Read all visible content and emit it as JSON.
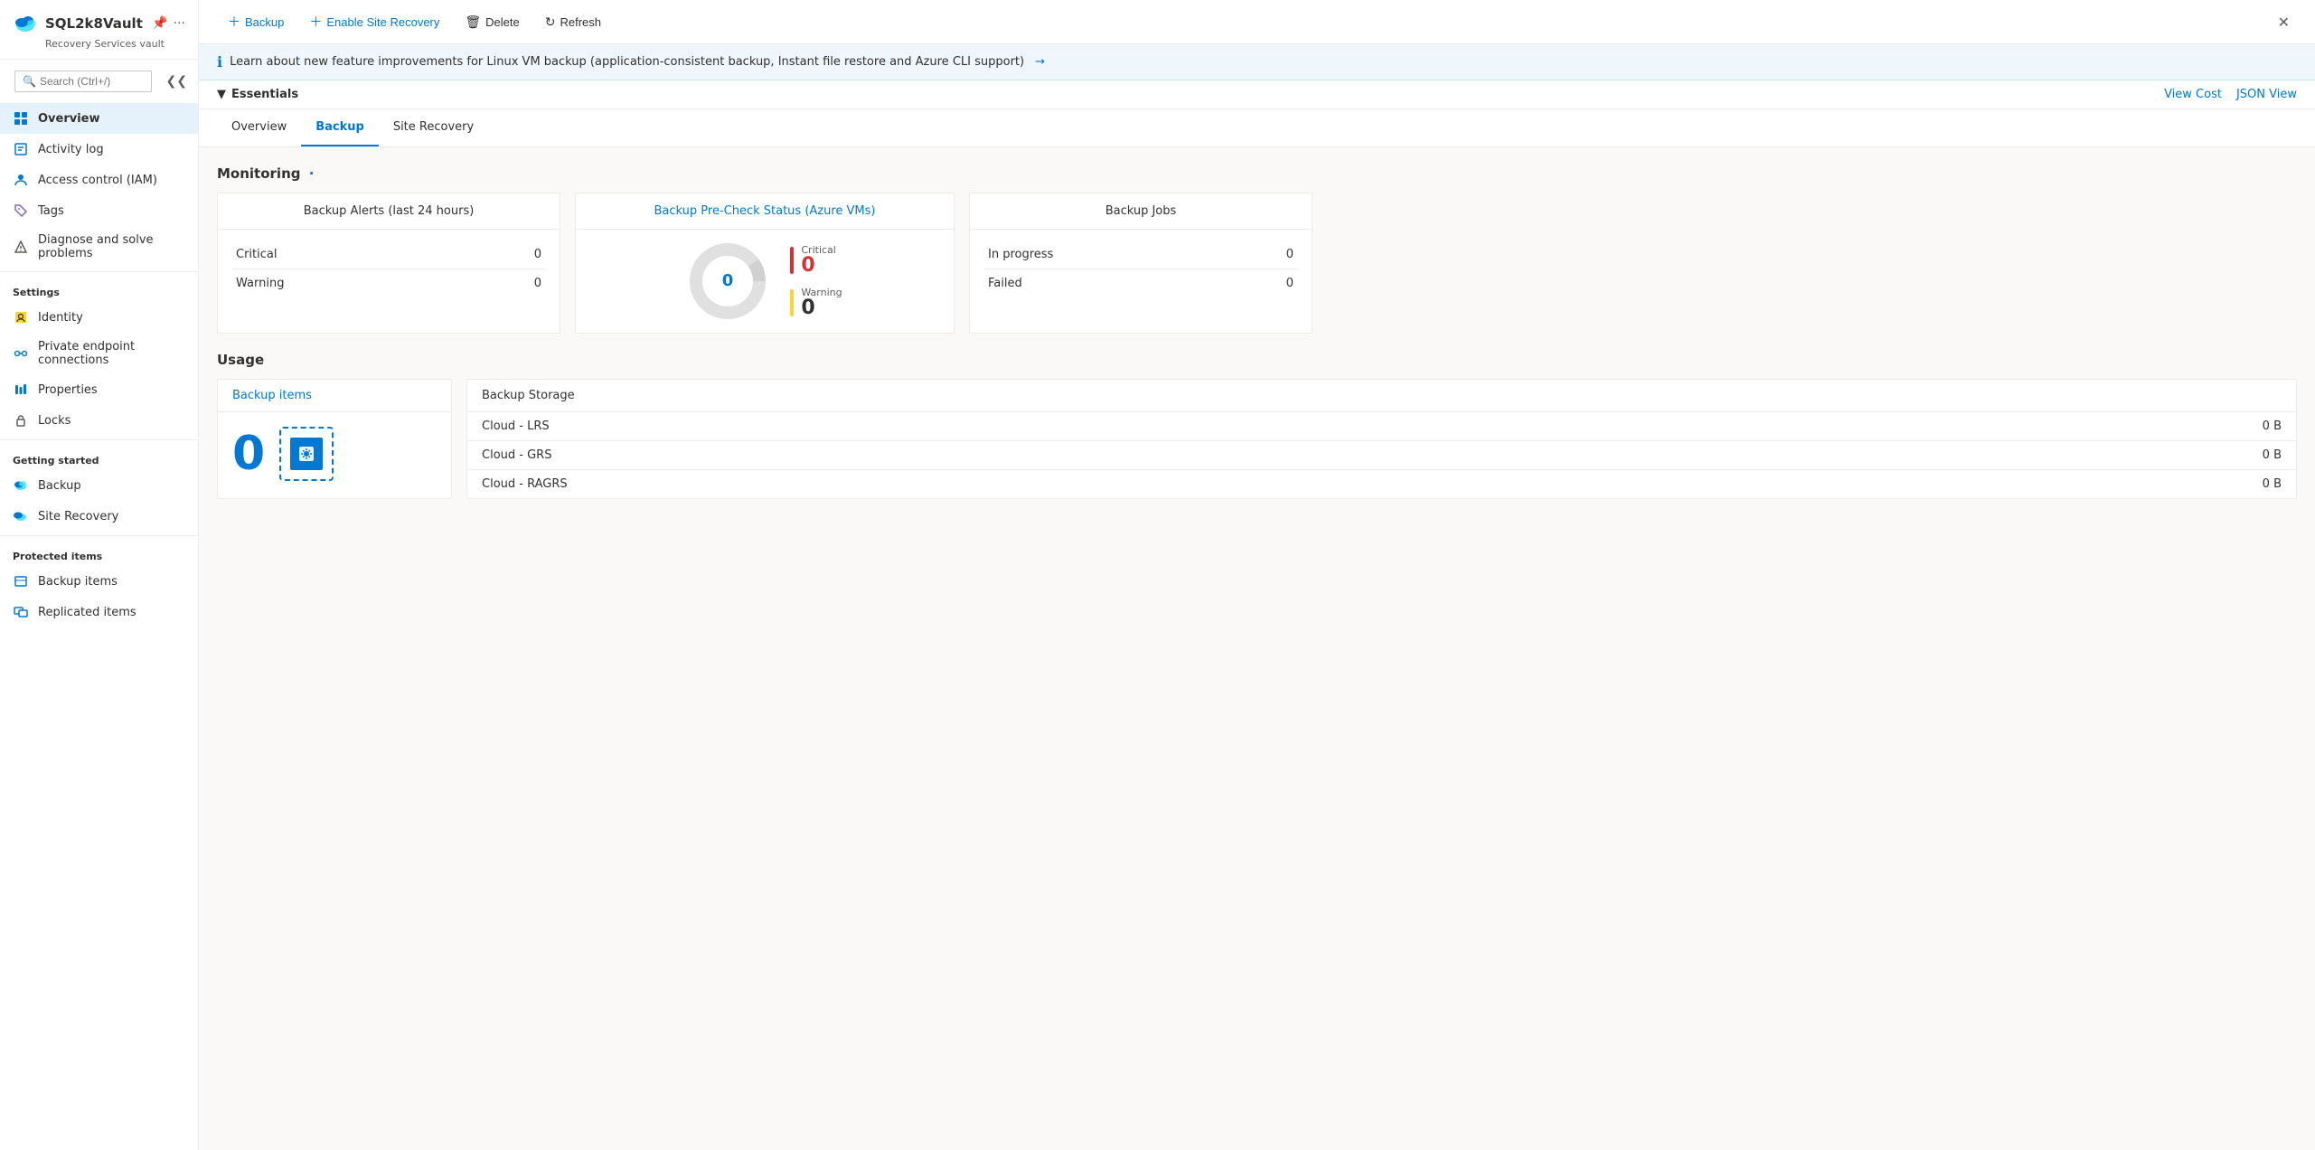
{
  "window": {
    "title": "SQL2k8Vault",
    "subtitle": "Recovery Services vault",
    "close_label": "✕"
  },
  "sidebar": {
    "search_placeholder": "Search (Ctrl+/)",
    "collapse_icon": "❮❮",
    "nav_items": [
      {
        "id": "overview",
        "label": "Overview",
        "icon": "overview",
        "active": true
      },
      {
        "id": "activity-log",
        "label": "Activity log",
        "icon": "activity"
      },
      {
        "id": "access-control",
        "label": "Access control (IAM)",
        "icon": "iam"
      },
      {
        "id": "tags",
        "label": "Tags",
        "icon": "tags"
      },
      {
        "id": "diagnose",
        "label": "Diagnose and solve problems",
        "icon": "diagnose"
      }
    ],
    "settings_label": "Settings",
    "settings_items": [
      {
        "id": "identity",
        "label": "Identity",
        "icon": "identity"
      },
      {
        "id": "private-endpoints",
        "label": "Private endpoint connections",
        "icon": "private-ep"
      },
      {
        "id": "properties",
        "label": "Properties",
        "icon": "properties"
      },
      {
        "id": "locks",
        "label": "Locks",
        "icon": "locks"
      }
    ],
    "getting_started_label": "Getting started",
    "getting_started_items": [
      {
        "id": "backup",
        "label": "Backup",
        "icon": "backup"
      },
      {
        "id": "site-recovery",
        "label": "Site Recovery",
        "icon": "site-recovery"
      }
    ],
    "protected_items_label": "Protected items",
    "protected_items": [
      {
        "id": "backup-items",
        "label": "Backup items",
        "icon": "backup-items"
      },
      {
        "id": "replicated-items",
        "label": "Replicated items",
        "icon": "replicated"
      }
    ]
  },
  "toolbar": {
    "backup_label": "Backup",
    "enable_site_recovery_label": "Enable Site Recovery",
    "delete_label": "Delete",
    "refresh_label": "Refresh"
  },
  "banner": {
    "text": "Learn about new feature improvements for Linux VM backup (application-consistent backup, Instant file restore and Azure CLI support)",
    "arrow": "→"
  },
  "essentials": {
    "label": "Essentials",
    "view_cost_label": "View Cost",
    "json_view_label": "JSON View"
  },
  "tabs": [
    {
      "id": "overview",
      "label": "Overview",
      "active": false
    },
    {
      "id": "backup",
      "label": "Backup",
      "active": true
    },
    {
      "id": "site-recovery",
      "label": "Site Recovery",
      "active": false
    }
  ],
  "monitoring": {
    "title": "Monitoring",
    "backup_alerts": {
      "title": "Backup Alerts (last 24 hours)",
      "rows": [
        {
          "label": "Critical",
          "value": "0"
        },
        {
          "label": "Warning",
          "value": "0"
        }
      ]
    },
    "pre_check": {
      "title": "Backup Pre-Check Status (Azure VMs)",
      "center_value": "0",
      "legend": [
        {
          "type": "critical",
          "label": "Critical",
          "value": "0"
        },
        {
          "type": "warning",
          "label": "Warning",
          "value": "0"
        }
      ]
    },
    "backup_jobs": {
      "title": "Backup Jobs",
      "rows": [
        {
          "label": "In progress",
          "value": "0"
        },
        {
          "label": "Failed",
          "value": "0"
        }
      ]
    }
  },
  "usage": {
    "title": "Usage",
    "backup_items": {
      "title": "Backup items",
      "count": "0"
    },
    "backup_storage": {
      "title": "Backup Storage",
      "rows": [
        {
          "label": "Cloud - LRS",
          "value": "0 B"
        },
        {
          "label": "Cloud - GRS",
          "value": "0 B"
        },
        {
          "label": "Cloud - RAGRS",
          "value": "0 B"
        }
      ]
    }
  },
  "colors": {
    "azure_blue": "#0078d4",
    "critical_red": "#d13438",
    "warning_yellow": "#ffd335"
  }
}
